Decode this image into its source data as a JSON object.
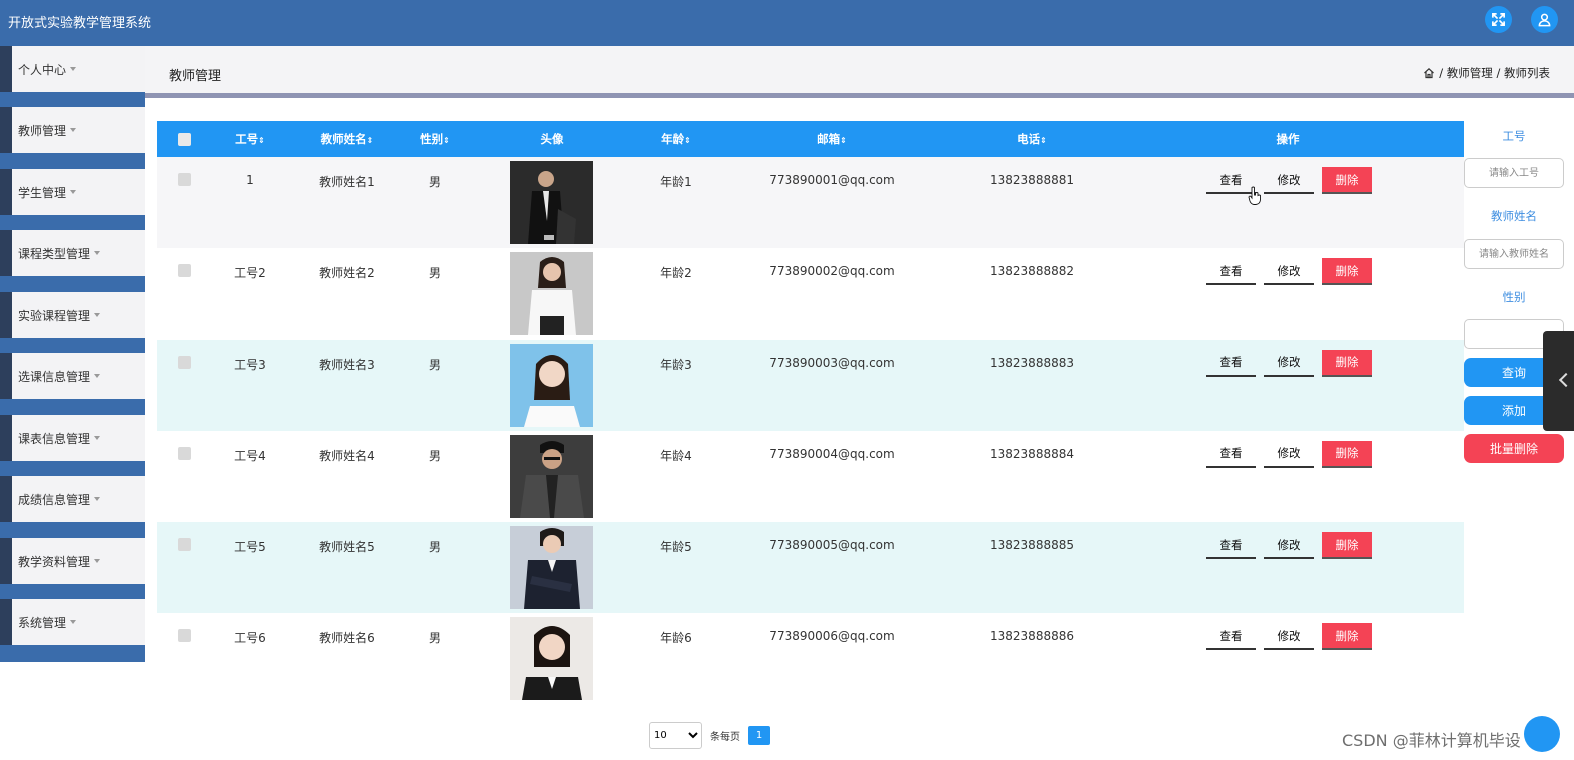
{
  "app": {
    "title": "开放式实验教学管理系统"
  },
  "header": {
    "fullscreen_icon": "expand-icon",
    "user_icon": "user-icon"
  },
  "sidebar": {
    "items": [
      {
        "label": "个人中心"
      },
      {
        "label": "教师管理"
      },
      {
        "label": "学生管理"
      },
      {
        "label": "课程类型管理"
      },
      {
        "label": "实验课程管理"
      },
      {
        "label": "选课信息管理"
      },
      {
        "label": "课表信息管理"
      },
      {
        "label": "成绩信息管理"
      },
      {
        "label": "教学资料管理"
      },
      {
        "label": "系统管理"
      }
    ]
  },
  "breadcrumb": {
    "title": "教师管理",
    "path": "/ 教师管理 / 教师列表"
  },
  "table": {
    "columns": {
      "id": "工号",
      "name": "教师姓名",
      "gender": "性别",
      "avatar": "头像",
      "age": "年龄",
      "email": "邮箱",
      "phone": "电话",
      "ops": "操作",
      "sort": "⇕"
    },
    "rows": [
      {
        "id": "1",
        "name": "教师姓名1",
        "gender": "男",
        "age": "年龄1",
        "email": "773890001@qq.com",
        "phone": "13823888881",
        "bg": "#f6f6f8"
      },
      {
        "id": "工号2",
        "name": "教师姓名2",
        "gender": "男",
        "age": "年龄2",
        "email": "773890002@qq.com",
        "phone": "13823888882",
        "bg": "#ffffff"
      },
      {
        "id": "工号3",
        "name": "教师姓名3",
        "gender": "男",
        "age": "年龄3",
        "email": "773890003@qq.com",
        "phone": "13823888883",
        "bg": "#e6f7f8"
      },
      {
        "id": "工号4",
        "name": "教师姓名4",
        "gender": "男",
        "age": "年龄4",
        "email": "773890004@qq.com",
        "phone": "13823888884",
        "bg": "#ffffff"
      },
      {
        "id": "工号5",
        "name": "教师姓名5",
        "gender": "男",
        "age": "年龄5",
        "email": "773890005@qq.com",
        "phone": "13823888885",
        "bg": "#e6f7f8"
      },
      {
        "id": "工号6",
        "name": "教师姓名6",
        "gender": "男",
        "age": "年龄6",
        "email": "773890006@qq.com",
        "phone": "13823888886",
        "bg": "#ffffff"
      }
    ],
    "actions": {
      "view": "查看",
      "edit": "修改",
      "delete": "删除"
    }
  },
  "search": {
    "id_label": "工号",
    "id_placeholder": "请输入工号",
    "name_label": "教师姓名",
    "name_placeholder": "请输入教师姓名",
    "gender_label": "性别",
    "query_button": "查询",
    "add_button": "添加",
    "batch_delete_button": "批量删除"
  },
  "pagination": {
    "page_size": "10",
    "per_page_label": "条每页",
    "current_page": "1"
  },
  "watermark": "CSDN @菲林计算机毕设",
  "colors": {
    "header": "#3a6cab",
    "primary": "#2196f3",
    "danger": "#f44355",
    "sidebar_stripe": "#2d3f5c"
  }
}
